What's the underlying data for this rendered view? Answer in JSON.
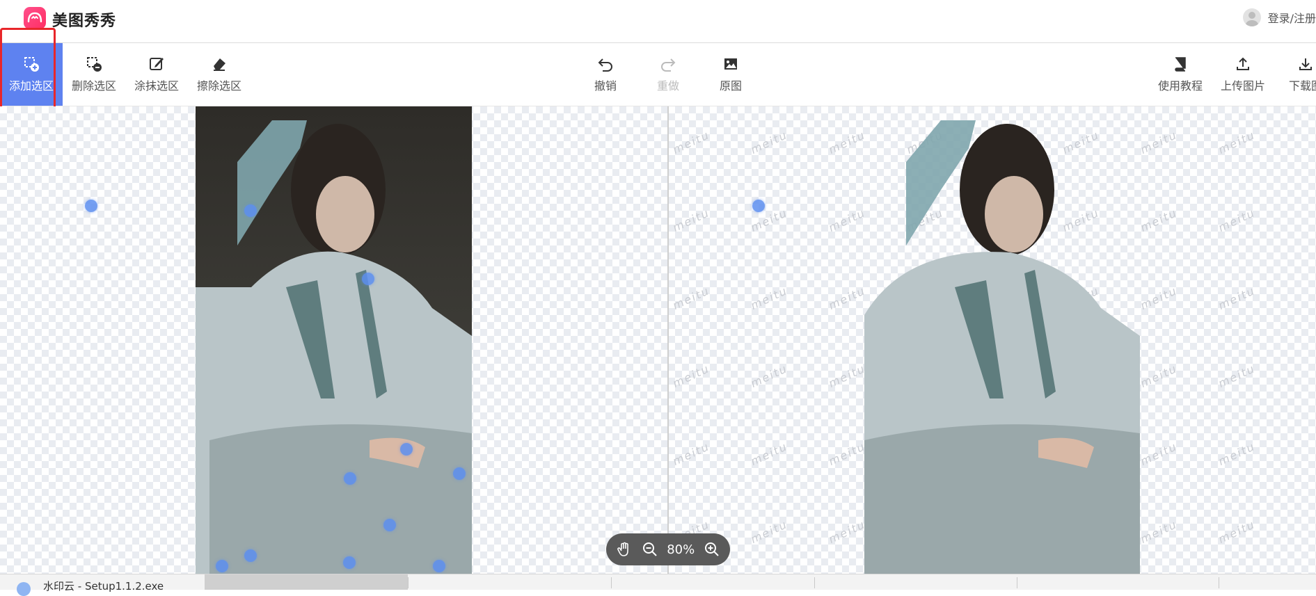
{
  "header": {
    "brand": "美图秀秀",
    "login_label": "登录/注册"
  },
  "toolbar": {
    "left_tools": [
      {
        "label": "添加选区",
        "icon": "add-selection-icon",
        "active": true
      },
      {
        "label": "删除选区",
        "icon": "remove-selection-icon",
        "active": false
      },
      {
        "label": "涂抹选区",
        "icon": "paint-selection-icon",
        "active": false
      },
      {
        "label": "擦除选区",
        "icon": "eraser-icon",
        "active": false
      }
    ],
    "center_tools": [
      {
        "label": "撤销",
        "icon": "undo-icon",
        "disabled": false
      },
      {
        "label": "重做",
        "icon": "redo-icon",
        "disabled": true
      },
      {
        "label": "原图",
        "icon": "image-icon",
        "disabled": false
      }
    ],
    "right_tools": [
      {
        "label": "使用教程",
        "icon": "book-icon"
      },
      {
        "label": "上传图片",
        "icon": "upload-icon"
      },
      {
        "label": "下载图",
        "icon": "download-icon"
      }
    ]
  },
  "canvas": {
    "watermark": "meitu"
  },
  "zoom": {
    "level": "80%"
  },
  "taskbar": {
    "item_label": "水印云 - Setup1.1.2.exe"
  },
  "colors": {
    "accent": "#5e82f0",
    "highlight": "#e8262a",
    "dot": "#5c8ef0"
  }
}
